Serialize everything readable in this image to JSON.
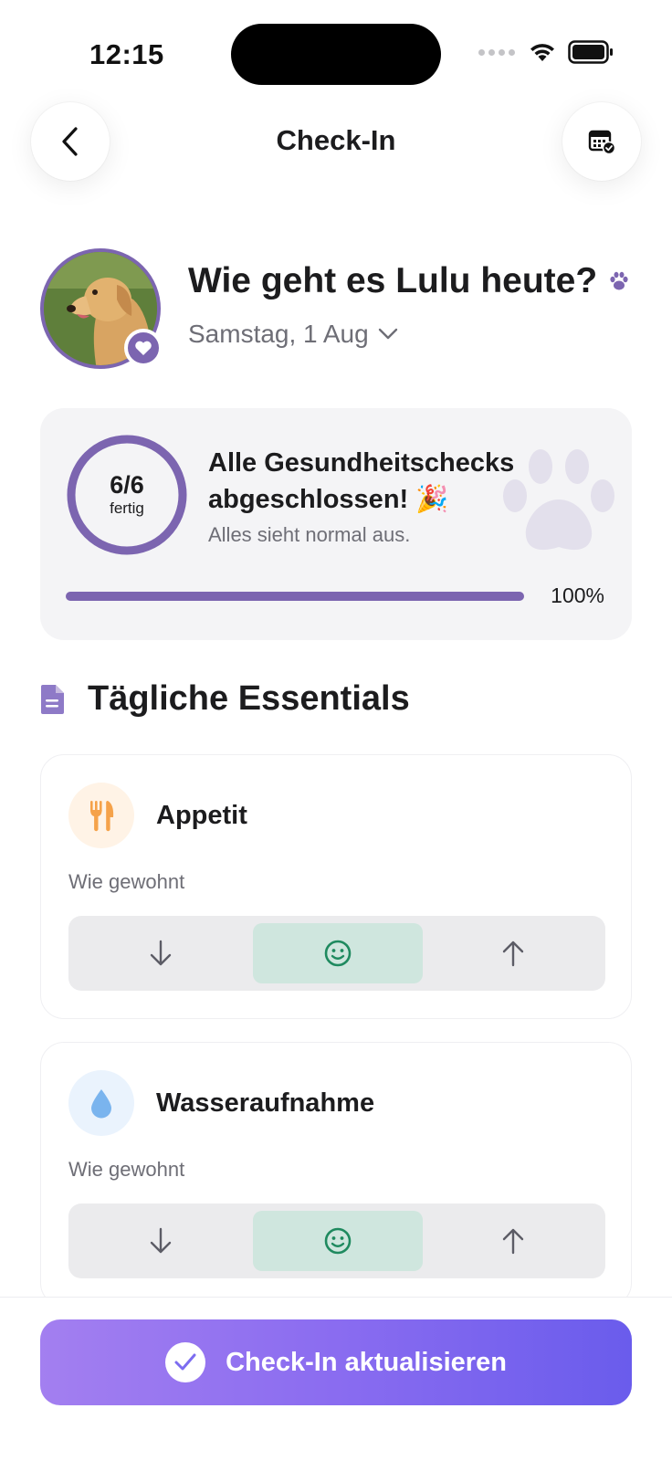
{
  "status_bar": {
    "time": "12:15"
  },
  "nav": {
    "title": "Check-In",
    "back_icon": "chevron-left-icon",
    "calendar_icon": "calendar-check-icon"
  },
  "profile": {
    "greeting": "Wie geht es Lulu heute?",
    "date": "Samstag, 1 Aug",
    "avatar": "golden-retriever-photo"
  },
  "summary": {
    "count": "6/6",
    "count_label": "fertig",
    "progress": 1.0,
    "title": "Alle Gesundheitschecks abgeschlossen! 🎉",
    "subtitle": "Alles sieht normal aus.",
    "percent": "100%"
  },
  "section": {
    "title": "Tägliche Essentials"
  },
  "metrics": [
    {
      "name": "Appetit",
      "status": "Wie gewohnt",
      "icon": "fork-knife-icon",
      "selected": "normal"
    },
    {
      "name": "Wasseraufnahme",
      "status": "Wie gewohnt",
      "icon": "water-drop-icon",
      "selected": "normal"
    }
  ],
  "cta": {
    "label": "Check-In aktualisieren"
  },
  "colors": {
    "accent": "#7c65b0",
    "normal_bg": "#cfe6de",
    "normal_icon": "#1f8a5f"
  }
}
